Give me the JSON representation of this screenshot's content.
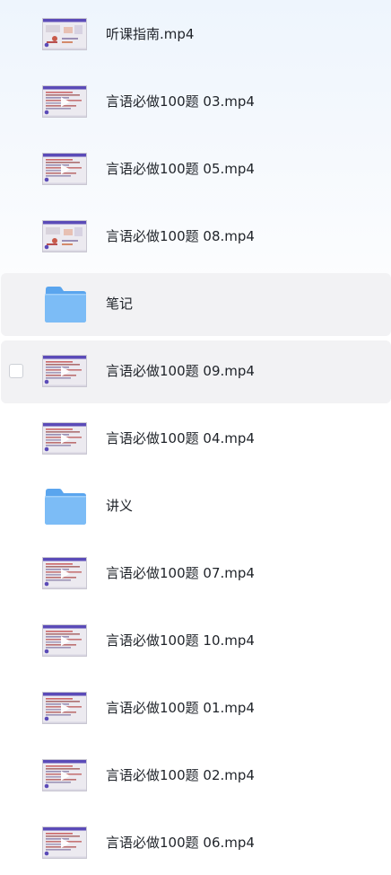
{
  "files": [
    {
      "name": "听课指南.mp4",
      "type": "video",
      "thumb": "map"
    },
    {
      "name": "言语必做100题 03.mp4",
      "type": "video",
      "thumb": "slide"
    },
    {
      "name": "言语必做100题 05.mp4",
      "type": "video",
      "thumb": "slide"
    },
    {
      "name": "言语必做100题 08.mp4",
      "type": "video",
      "thumb": "map"
    },
    {
      "name": "笔记",
      "type": "folder",
      "highlighted": true
    },
    {
      "name": "言语必做100题 09.mp4",
      "type": "video",
      "thumb": "slide",
      "highlighted": true,
      "hovered": true
    },
    {
      "name": "言语必做100题 04.mp4",
      "type": "video",
      "thumb": "slide"
    },
    {
      "name": "讲义",
      "type": "folder"
    },
    {
      "name": "言语必做100题 07.mp4",
      "type": "video",
      "thumb": "slide"
    },
    {
      "name": "言语必做100题 10.mp4",
      "type": "video",
      "thumb": "slide"
    },
    {
      "name": "言语必做100题 01.mp4",
      "type": "video",
      "thumb": "slide"
    },
    {
      "name": "言语必做100题 02.mp4",
      "type": "video",
      "thumb": "slide"
    },
    {
      "name": "言语必做100题 06.mp4",
      "type": "video",
      "thumb": "slide"
    }
  ],
  "colors": {
    "row_highlight": "#f2f2f4",
    "folder_back": "#5aa5ee",
    "folder_front": "#7cbcf6",
    "thumb_header": "#5b4bb8",
    "thumb_body": "#eceaf0",
    "text": "#1f2329"
  }
}
